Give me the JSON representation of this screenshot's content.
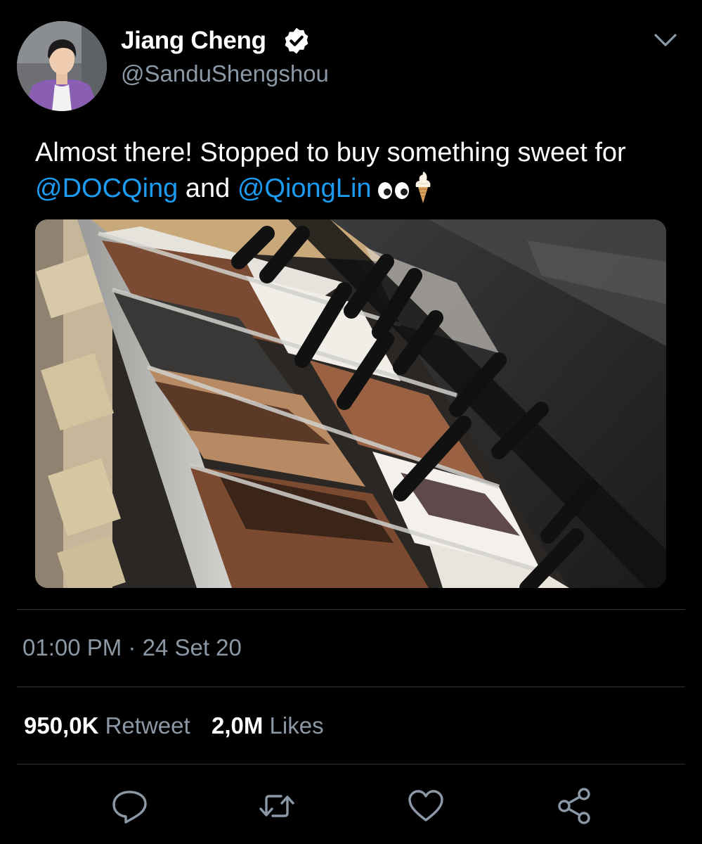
{
  "author": {
    "display_name": "Jiang Cheng",
    "handle": "@SanduShengshou",
    "verified_icon": "verified-badge-icon",
    "avatar_icon": "avatar"
  },
  "tweet": {
    "text_part1": "Almost there! Stopped to buy something sweet for ",
    "mention1": "@DOCQing",
    "text_part2": " and ",
    "mention2": "@QiongLin",
    "emoji_icons": [
      "eyes-emoji",
      "soft-ice-cream-emoji"
    ],
    "media_icon": "photo-gelato-display-case"
  },
  "meta": {
    "timestamp": "01:00 PM · 24 Set 20"
  },
  "stats": {
    "retweets_count": "950,0K",
    "retweets_label": "Retweet",
    "likes_count": "2,0M",
    "likes_label": "Likes"
  },
  "actions": [
    {
      "name": "reply",
      "icon": "speech-bubble-icon"
    },
    {
      "name": "retweet",
      "icon": "retweet-icon"
    },
    {
      "name": "like",
      "icon": "heart-icon"
    },
    {
      "name": "share",
      "icon": "share-icon"
    }
  ],
  "colors": {
    "background": "#000000",
    "primary_text": "#ffffff",
    "secondary_text": "#8b98a5",
    "link": "#1d9bf0",
    "divider": "#2f3336"
  }
}
